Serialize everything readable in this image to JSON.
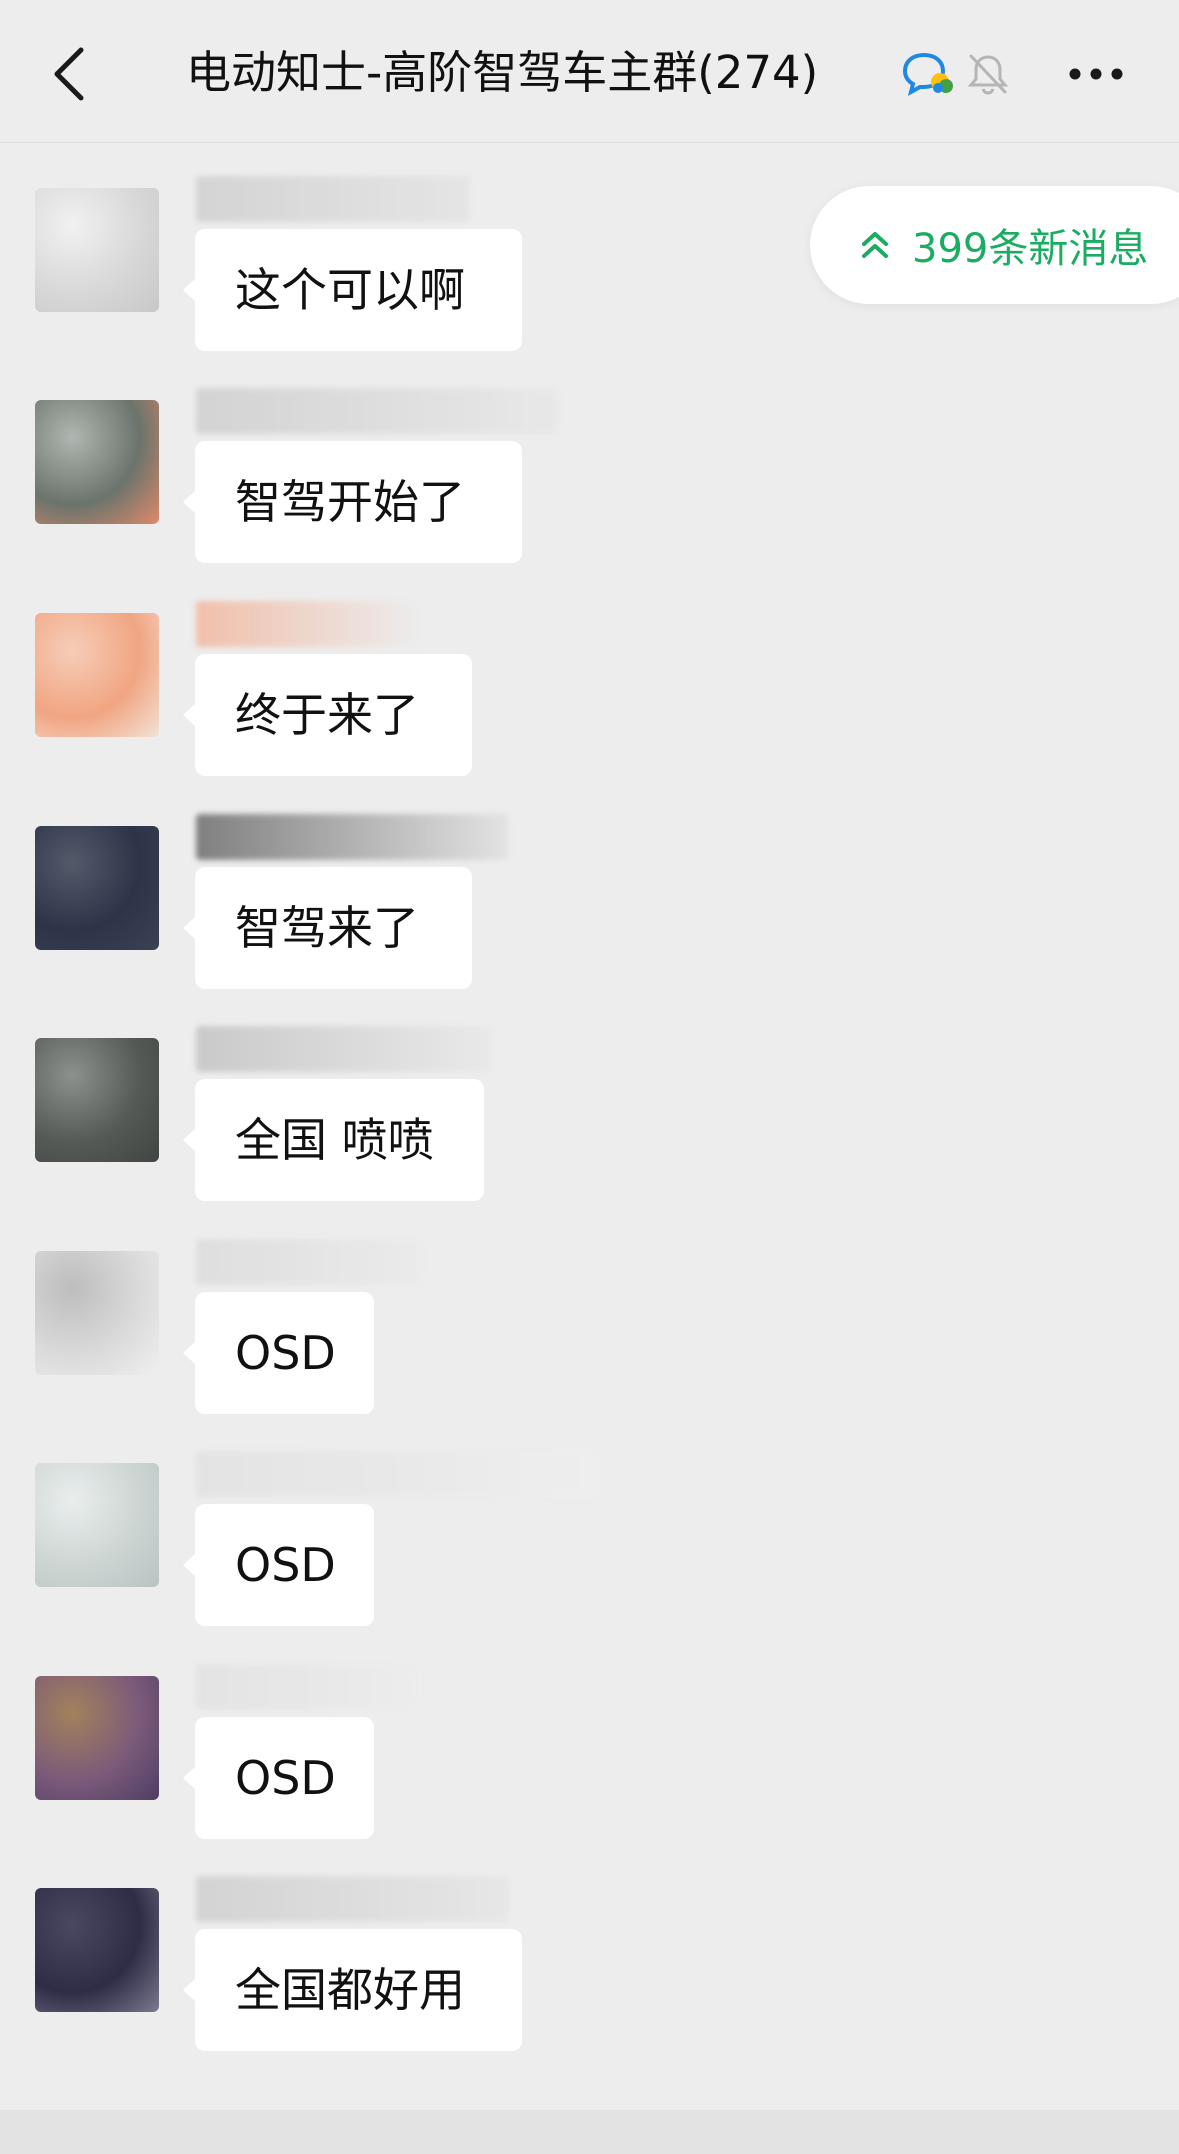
{
  "header": {
    "back_icon": "chevron-left-icon",
    "title": "电动知士-高阶智驾车主群(274)",
    "chat_badge_icon": "group-chat-icon",
    "mute_icon": "bell-off-icon",
    "more_icon": "ellipsis-icon"
  },
  "new_messages": {
    "icon": "double-chevron-up-icon",
    "label": "399条新消息",
    "color": "#1aad62"
  },
  "messages": [
    {
      "text": "这个可以啊",
      "avatar_colors": [
        "#d8d8d8",
        "#f1f1f1",
        "#c8c8c8"
      ],
      "sender_colors": [
        "#d0d0d0",
        "#e4e4e4"
      ]
    },
    {
      "text": "智驾开始了",
      "avatar_colors": [
        "#6b746c",
        "#b0b6b1",
        "#e0896a"
      ],
      "sender_colors": [
        "#cfcfcf",
        "#e8e8e8"
      ]
    },
    {
      "text": "终于来了",
      "avatar_colors": [
        "#f1a582",
        "#f6cdb8",
        "#f3e1d5"
      ],
      "sender_colors": [
        "#f2b8a0",
        "#ececec"
      ]
    },
    {
      "text": "智驾来了",
      "avatar_colors": [
        "#2e3448",
        "#535a6a",
        "#3c4255"
      ],
      "sender_colors": [
        "#6d6d6d",
        "#e2e2e2"
      ]
    },
    {
      "text": "全国 喷喷",
      "avatar_colors": [
        "#555a56",
        "#8c918d",
        "#404542"
      ],
      "sender_colors": [
        "#c4c4c4",
        "#e9e9e9"
      ]
    },
    {
      "text": "OSD",
      "avatar_colors": [
        "#dadada",
        "#bdbdbd",
        "#efefef"
      ],
      "sender_colors": [
        "#dcdcdc",
        "#ebebeb"
      ]
    },
    {
      "text": "OSD",
      "avatar_colors": [
        "#cdd5d3",
        "#e9eeed",
        "#b9c3c2"
      ],
      "sender_colors": [
        "#e2e2e2",
        "#efefef"
      ]
    },
    {
      "text": "OSD",
      "avatar_colors": [
        "#7b5a7a",
        "#a3815c",
        "#4e3e63"
      ],
      "sender_colors": [
        "#e2e2e2",
        "#ededed"
      ]
    },
    {
      "text": "全国都好用",
      "avatar_colors": [
        "#2f2c45",
        "#4a4860",
        "#7a7a90"
      ],
      "sender_colors": [
        "#cfcfcf",
        "#e6e6e6"
      ]
    }
  ]
}
